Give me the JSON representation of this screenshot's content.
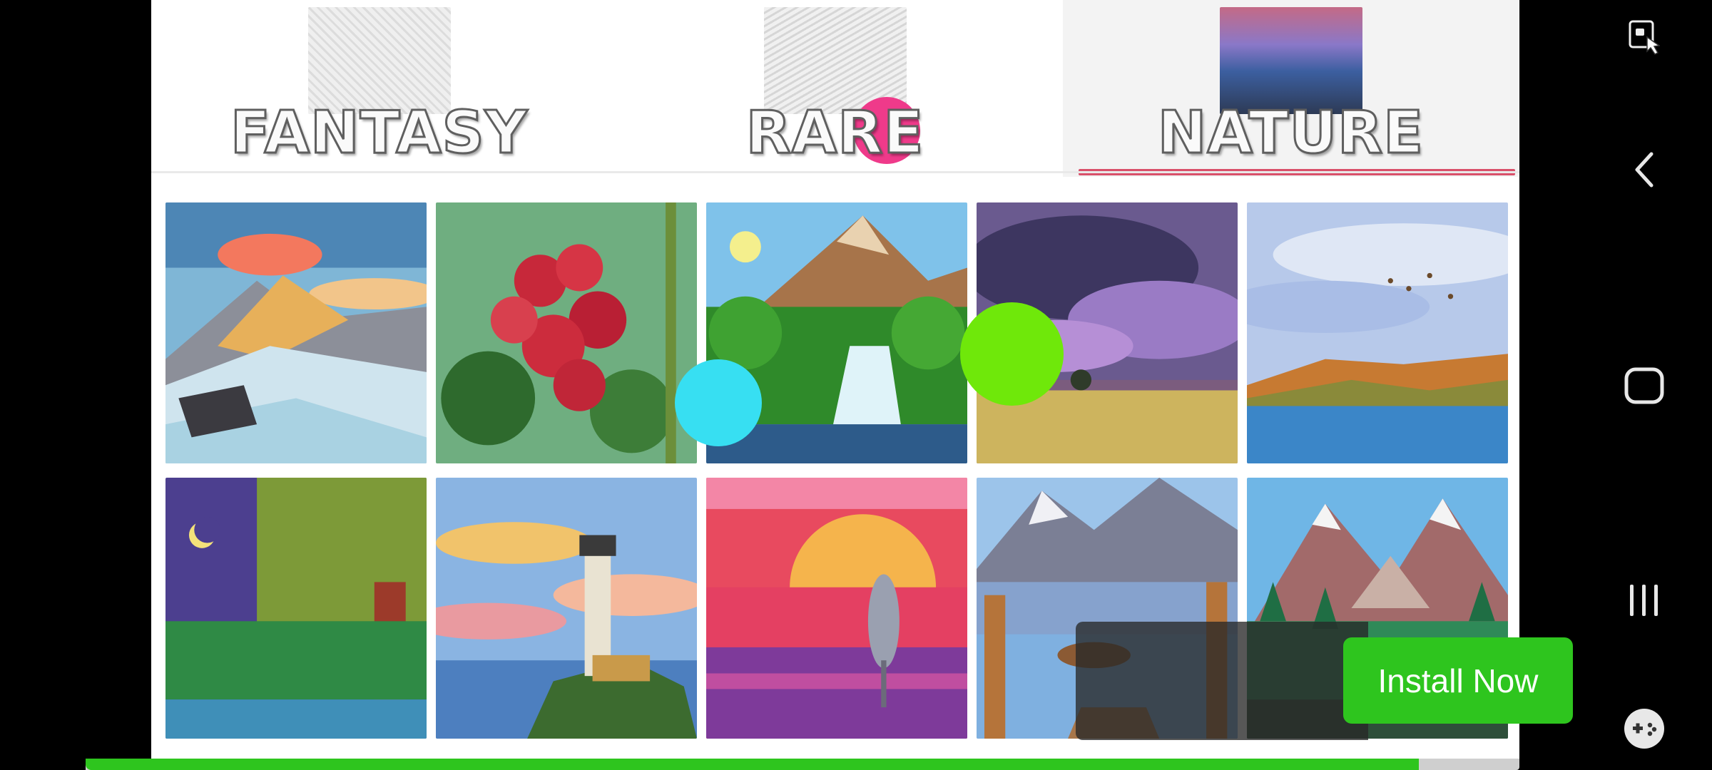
{
  "categories": [
    {
      "label": "FANTASY",
      "thumb": "sketch-portrait"
    },
    {
      "label": "RARE",
      "thumb": "sketch-animal"
    },
    {
      "label": "NATURE",
      "thumb": "sunset-lake"
    }
  ],
  "selected_category": "NATURE",
  "accent_color": "#d9506a",
  "gallery": {
    "tiles": [
      {
        "subject": "mountain-sunset"
      },
      {
        "subject": "red-berries"
      },
      {
        "subject": "waterfall"
      },
      {
        "subject": "storm-field"
      },
      {
        "subject": "lake-birds"
      },
      {
        "subject": "willow-tree-night"
      },
      {
        "subject": "lighthouse"
      },
      {
        "subject": "heron-sunset"
      },
      {
        "subject": "lake-boat-dock"
      },
      {
        "subject": "mountain-forest"
      }
    ]
  },
  "ad": {
    "install_label": "Install Now",
    "button_color": "#2ec51e"
  },
  "progress": {
    "fraction": 0.93
  },
  "touch_indicators": [
    {
      "color": "#ef3a8a"
    },
    {
      "color": "#37dff2"
    },
    {
      "color": "#6fe80a"
    }
  ],
  "navigation": {
    "icons": [
      "screen-lock-icon",
      "back-icon",
      "home-icon",
      "recents-icon",
      "game-launcher-icon"
    ]
  }
}
